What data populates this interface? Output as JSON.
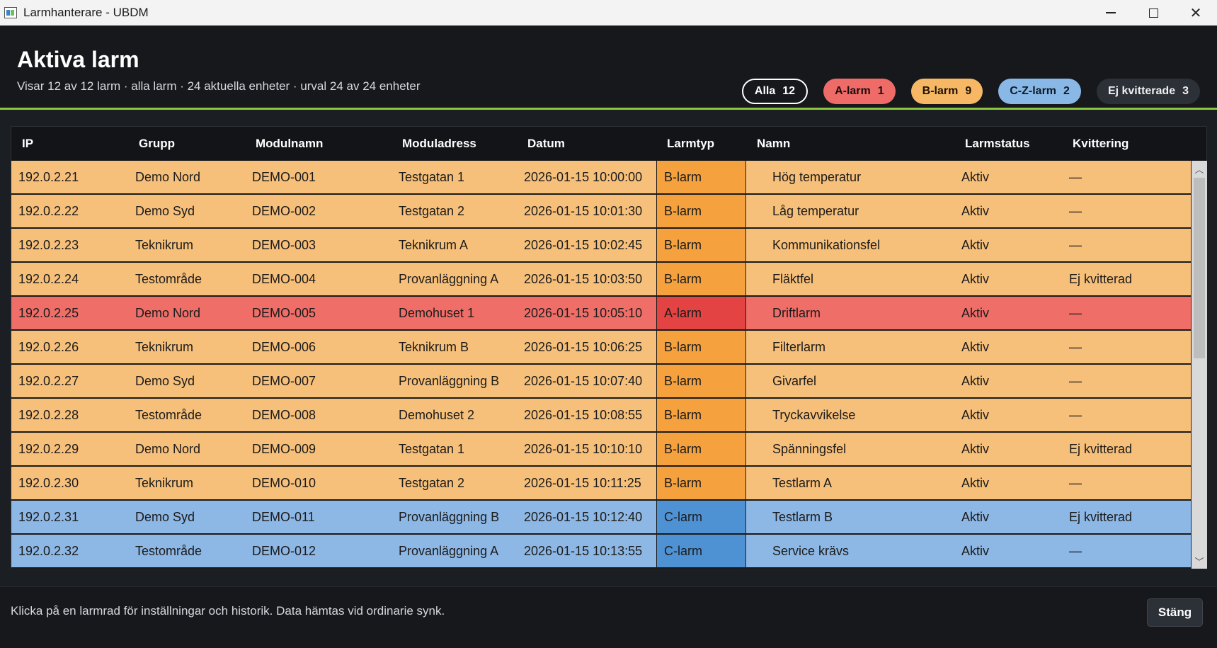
{
  "window": {
    "title": "Larmhanterare - UBDM",
    "icon": "app-icon",
    "controls": [
      "minimize-icon",
      "maximize-icon",
      "close-icon"
    ]
  },
  "header": {
    "title": "Aktiva larm",
    "subtitle": "Visar 12 av 12 larm · alla larm · 24 aktuella enheter · urval 24 av 24 enheter",
    "accent_color": "#8cc63f"
  },
  "filters": [
    {
      "label": "Alla",
      "count": "12",
      "color": "#16181c"
    },
    {
      "label": "A-larm",
      "count": "1",
      "color": "#ef6b68"
    },
    {
      "label": "B-larm",
      "count": "9",
      "color": "#f7b865"
    },
    {
      "label": "C-Z-larm",
      "count": "2",
      "color": "#8ab8e6"
    },
    {
      "label": "Ej kvitterade",
      "count": "3",
      "color": "#2c3037"
    }
  ],
  "table": {
    "columns": [
      "IP",
      "Grupp",
      "Modulnamn",
      "Moduladress",
      "Datum",
      "Larmtyp",
      "Namn",
      "Larmstatus",
      "Kvittering"
    ],
    "rows": [
      {
        "kind": "b",
        "cells": [
          "192.0.2.21",
          "Demo Nord",
          "DEMO-001",
          "Testgatan 1",
          "2026-01-15 10:00:00",
          "B-larm",
          "Hög temperatur",
          "Aktiv",
          "—"
        ]
      },
      {
        "kind": "b",
        "cells": [
          "192.0.2.22",
          "Demo Syd",
          "DEMO-002",
          "Testgatan 2",
          "2026-01-15 10:01:30",
          "B-larm",
          "Låg temperatur",
          "Aktiv",
          "—"
        ]
      },
      {
        "kind": "b",
        "cells": [
          "192.0.2.23",
          "Teknikrum",
          "DEMO-003",
          "Teknikrum A",
          "2026-01-15 10:02:45",
          "B-larm",
          "Kommunikationsfel",
          "Aktiv",
          "—"
        ]
      },
      {
        "kind": "b",
        "cells": [
          "192.0.2.24",
          "Testområde",
          "DEMO-004",
          "Provanläggning A",
          "2026-01-15 10:03:50",
          "B-larm",
          "Fläktfel",
          "Aktiv",
          "Ej kvitterad"
        ]
      },
      {
        "kind": "a",
        "cells": [
          "192.0.2.25",
          "Demo Nord",
          "DEMO-005",
          "Demohuset 1",
          "2026-01-15 10:05:10",
          "A-larm",
          "Driftlarm",
          "Aktiv",
          "—"
        ]
      },
      {
        "kind": "b",
        "cells": [
          "192.0.2.26",
          "Teknikrum",
          "DEMO-006",
          "Teknikrum B",
          "2026-01-15 10:06:25",
          "B-larm",
          "Filterlarm",
          "Aktiv",
          "—"
        ]
      },
      {
        "kind": "b",
        "cells": [
          "192.0.2.27",
          "Demo Syd",
          "DEMO-007",
          "Provanläggning B",
          "2026-01-15 10:07:40",
          "B-larm",
          "Givarfel",
          "Aktiv",
          "—"
        ]
      },
      {
        "kind": "b",
        "cells": [
          "192.0.2.28",
          "Testområde",
          "DEMO-008",
          "Demohuset 2",
          "2026-01-15 10:08:55",
          "B-larm",
          "Tryckavvikelse",
          "Aktiv",
          "—"
        ]
      },
      {
        "kind": "b",
        "cells": [
          "192.0.2.29",
          "Demo Nord",
          "DEMO-009",
          "Testgatan 1",
          "2026-01-15 10:10:10",
          "B-larm",
          "Spänningsfel",
          "Aktiv",
          "Ej kvitterad"
        ]
      },
      {
        "kind": "b",
        "cells": [
          "192.0.2.30",
          "Teknikrum",
          "DEMO-010",
          "Testgatan 2",
          "2026-01-15 10:11:25",
          "B-larm",
          "Testlarm A",
          "Aktiv",
          "—"
        ]
      },
      {
        "kind": "c",
        "cells": [
          "192.0.2.31",
          "Demo Syd",
          "DEMO-011",
          "Provanläggning B",
          "2026-01-15 10:12:40",
          "C-larm",
          "Testlarm B",
          "Aktiv",
          "Ej kvitterad"
        ]
      },
      {
        "kind": "c",
        "cells": [
          "192.0.2.32",
          "Testområde",
          "DEMO-012",
          "Provanläggning A",
          "2026-01-15 10:13:55",
          "C-larm",
          "Service krävs",
          "Aktiv",
          "—"
        ]
      }
    ],
    "row_colors": {
      "a": "#f06e68",
      "b": "#f7c07a",
      "c": "#8db7e4"
    },
    "type_colors": {
      "a": "#e34343",
      "b": "#f5a13e",
      "c": "#4f92d4"
    }
  },
  "footer": {
    "hint": "Klicka på en larmrad för inställningar och historik. Data hämtas vid ordinarie synk.",
    "close_label": "Stäng"
  }
}
